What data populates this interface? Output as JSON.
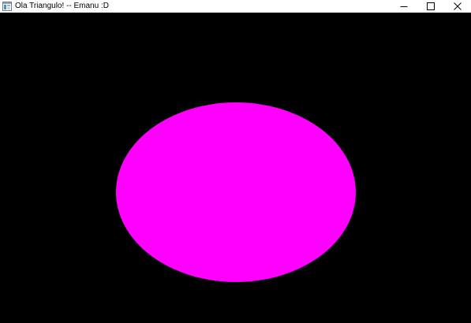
{
  "window": {
    "title": "Ola Triangulo! -- Emanu :D",
    "icon": "app-window-icon",
    "controls": {
      "minimize_icon": "minimize-icon",
      "maximize_icon": "maximize-icon",
      "close_icon": "close-icon"
    }
  },
  "scene": {
    "background_color": "#000000",
    "shape": "ellipse",
    "shape_color": "#ff00ff"
  }
}
